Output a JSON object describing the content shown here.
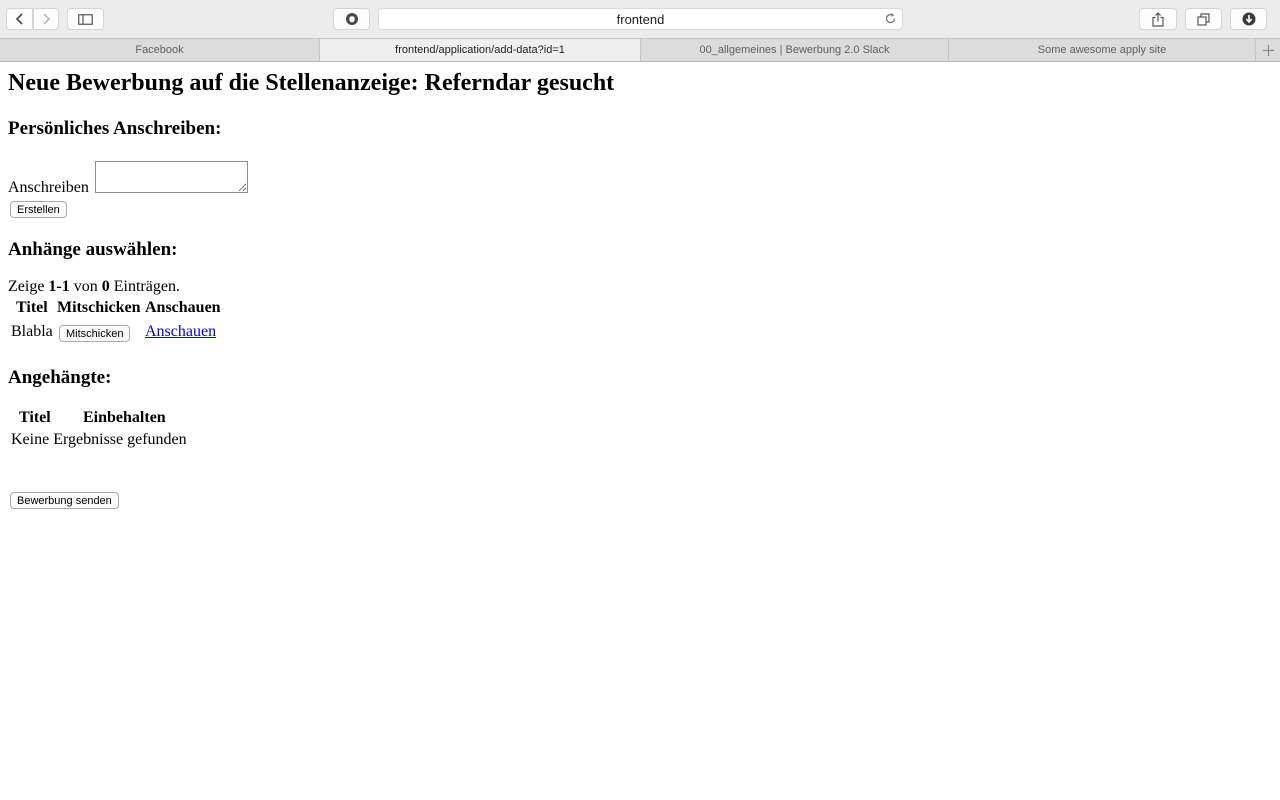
{
  "browser": {
    "url": "frontend",
    "tabs": [
      {
        "label": "Facebook",
        "active": false
      },
      {
        "label": "frontend/application/add-data?id=1",
        "active": true
      },
      {
        "label": "00_allgemeines | Bewerbung 2.0 Slack",
        "active": false
      },
      {
        "label": "Some awesome apply site",
        "active": false
      }
    ],
    "icons": [
      "back-icon",
      "forward-icon",
      "sidebar-icon",
      "privacy-shield-icon",
      "reload-icon",
      "share-icon",
      "tabs-overview-icon",
      "downloads-icon",
      "new-tab-icon"
    ]
  },
  "page": {
    "title": "Neue Bewerbung auf die Stellenanzeige: Referndar gesucht",
    "cover_letter": {
      "heading": "Persönliches Anschreiben:",
      "field_label": "Anschreiben",
      "field_value": "",
      "create_button": "Erstellen"
    },
    "attachments": {
      "heading": "Anhänge auswählen:",
      "summary": {
        "prefix": "Zeige ",
        "range": "1-1",
        "middle": " von ",
        "total": "0",
        "suffix": " Einträgen."
      },
      "columns": [
        "Titel",
        "Mitschicken",
        "Anschauen"
      ],
      "rows": [
        {
          "title": "Blabla",
          "send_button": "Mitschicken",
          "view_link": "Anschauen"
        }
      ]
    },
    "attached": {
      "heading": "Angehängte:",
      "columns": [
        "Titel",
        "Einbehalten"
      ],
      "empty_text": "Keine Ergebnisse gefunden"
    },
    "submit_button": "Bewerbung senden"
  }
}
